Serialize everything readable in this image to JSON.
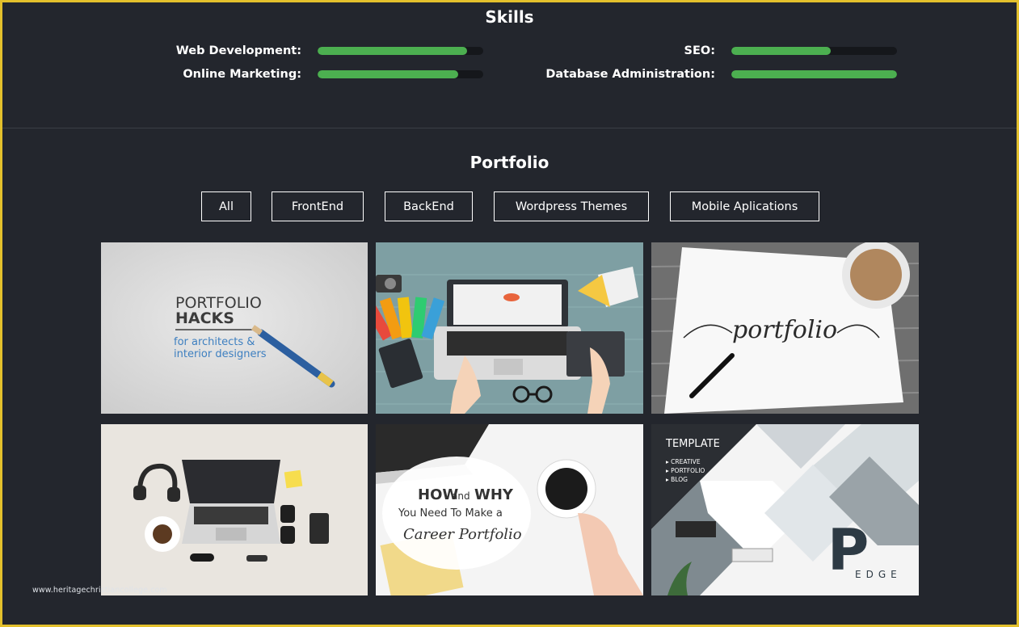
{
  "skills": {
    "title": "Skills",
    "items": [
      {
        "label": "Web Development:",
        "level": 0.9
      },
      {
        "label": "SEO:",
        "level": 0.6
      },
      {
        "label": "Online Marketing:",
        "level": 0.85
      },
      {
        "label": "Database Administration:",
        "level": 1.0
      }
    ]
  },
  "portfolio": {
    "title": "Portfolio",
    "filters": [
      {
        "label": "All"
      },
      {
        "label": "FrontEnd"
      },
      {
        "label": "BackEnd"
      },
      {
        "label": "Wordpress Themes"
      },
      {
        "label": "Mobile Aplications"
      }
    ],
    "tiles": [
      {
        "line1": "PORTFOLIO",
        "line2": "HACKS",
        "line3": "for architects &",
        "line4": "interior designers"
      },
      {
        "desc": "designer desk"
      },
      {
        "script": "portfolio"
      },
      {
        "desc": "workspace flatlay"
      },
      {
        "line1": "HOW",
        "and": "and",
        "why": "WHY",
        "line2": "You Need To Make a",
        "line3": "Career Portfolio"
      },
      {
        "title": "TEMPLATE",
        "menu": [
          "CREATIVE",
          "PORTFOLIO",
          "BLOG"
        ],
        "logo": "P",
        "edge": "EDGE"
      }
    ]
  },
  "watermark": "www.heritagechristiancollege.com",
  "colors": {
    "accent_fill": "#4caf50",
    "frame": "#e3c02c",
    "background": "#23262d"
  }
}
